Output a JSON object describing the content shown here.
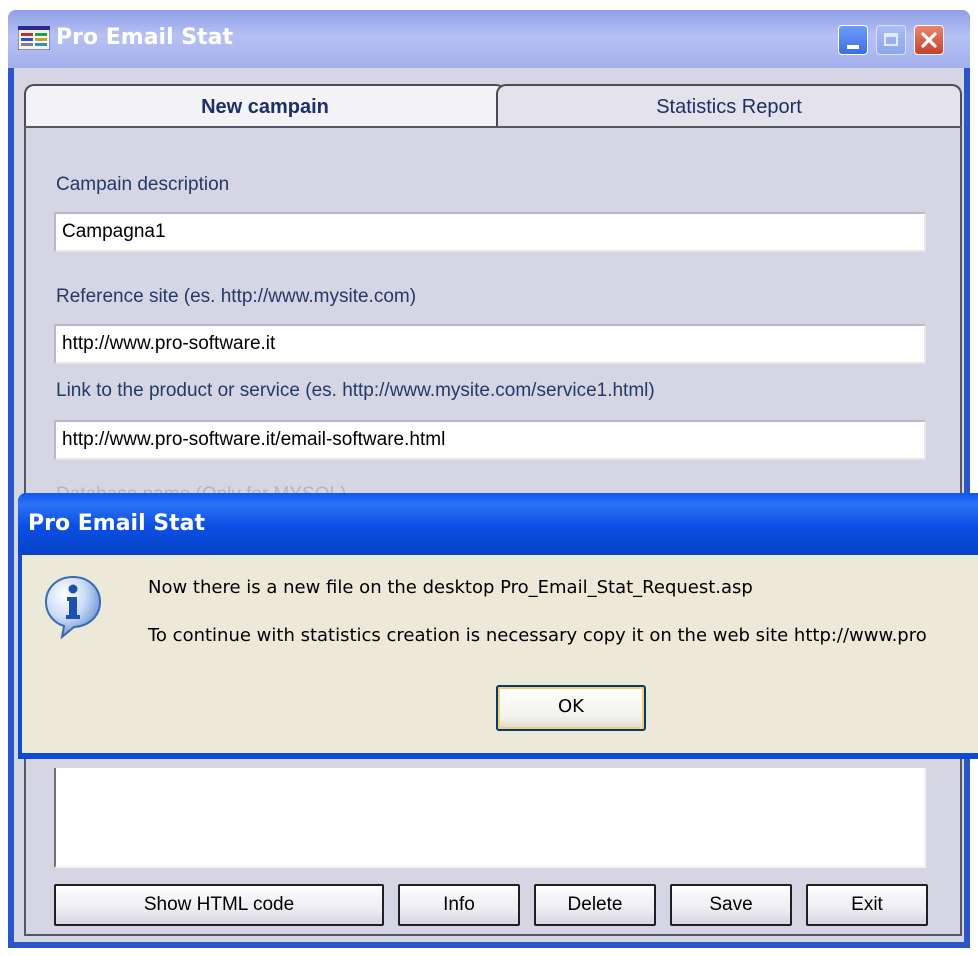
{
  "window": {
    "title": "Pro Email Stat",
    "icon": "application-icon"
  },
  "tabs": [
    {
      "label": "New campain",
      "active": true
    },
    {
      "label": "Statistics Report",
      "active": false
    }
  ],
  "form": {
    "campain_description_label": "Campain description",
    "campain_description_value": "Campagna1",
    "reference_site_label": "Reference site (es. http://www.mysite.com)",
    "reference_site_value": "http://www.pro-software.it",
    "product_link_label": "Link to the product or service (es. http://www.mysite.com/service1.html)",
    "product_link_value": "http://www.pro-software.it/email-software.html",
    "database_name_label": "Database name (Only for MYSQL)"
  },
  "buttons": {
    "show_html": "Show HTML code",
    "info": "Info",
    "delete": "Delete",
    "save": "Save",
    "exit": "Exit"
  },
  "dialog": {
    "title": "Pro Email Stat",
    "icon": "info-icon",
    "line1": "Now there is a new file on the desktop Pro_Email_Stat_Request.asp",
    "line2": "To continue with statistics creation is necessary copy it on the web site http://www.pro",
    "ok_label": "OK"
  },
  "colors": {
    "titlebar_main": "#a3b0ec",
    "dialog_titlebar": "#0a4ee2",
    "panel_bg": "#d6d5e3",
    "dialog_bg": "#ece9d8"
  }
}
